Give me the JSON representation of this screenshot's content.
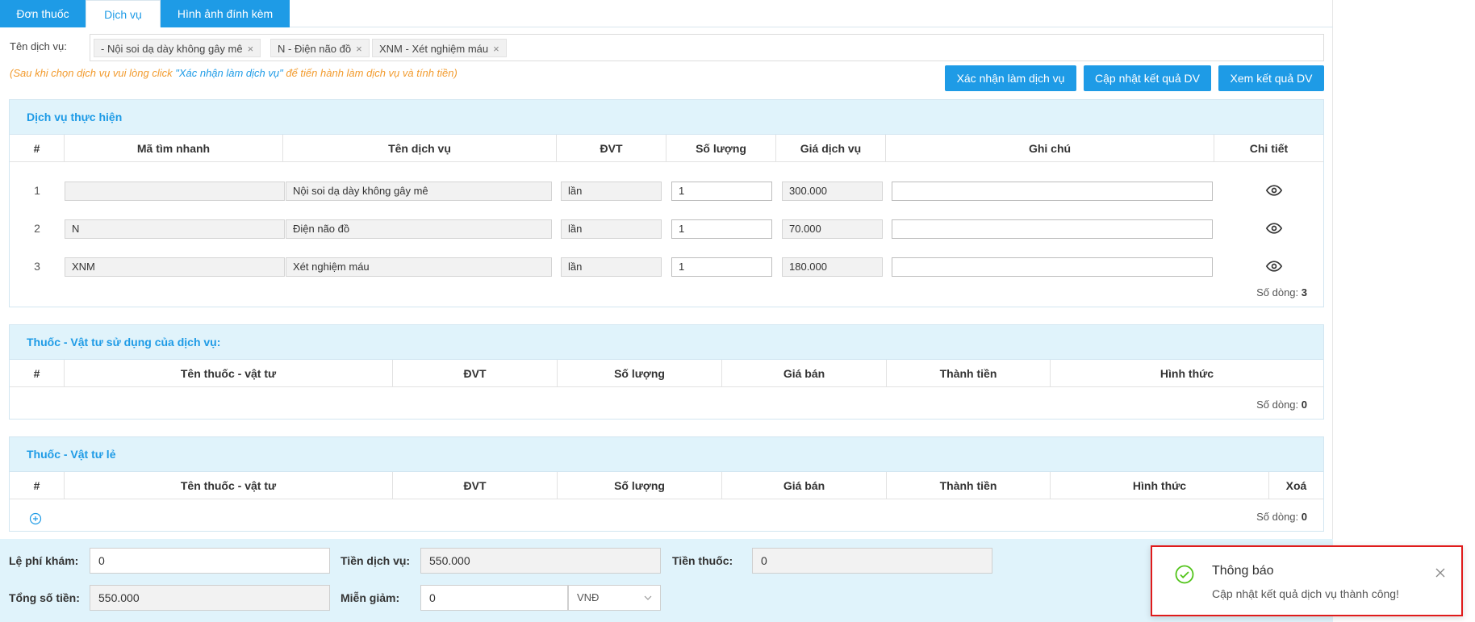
{
  "tabs": [
    {
      "label": "Đơn thuốc"
    },
    {
      "label": "Dịch vụ"
    },
    {
      "label": "Hình ảnh đính kèm"
    }
  ],
  "service_select": {
    "label": "Tên dịch vụ:",
    "tags": [
      {
        "label": "- Nội soi dạ dày không gây mê"
      },
      {
        "label": "N - Điện não đồ"
      },
      {
        "label": "XNM - Xét nghiệm máu"
      }
    ]
  },
  "hint": {
    "prefix": "(Sau khi chọn dịch vụ vui lòng click ",
    "highlight": "\"Xác nhận làm dịch vụ\"",
    "suffix": " để tiến hành làm dịch vụ và tính tiền)"
  },
  "actions": {
    "confirm": "Xác nhận làm dịch vụ",
    "update_result": "Cập nhật kết quả DV",
    "view_result": "Xem kết quả DV"
  },
  "services_panel": {
    "title": "Dịch vụ thực hiện",
    "columns": [
      "#",
      "Mã tìm nhanh",
      "Tên dịch vụ",
      "ĐVT",
      "Số lượng",
      "Giá dịch vụ",
      "Ghi chú",
      "Chi tiết"
    ],
    "rows": [
      {
        "num": "1",
        "code": "",
        "name": "Nội soi dạ dày không gây mê",
        "unit": "lần",
        "qty": "1",
        "price": "300.000",
        "note": ""
      },
      {
        "num": "2",
        "code": "N",
        "name": "Điện não đồ",
        "unit": "lần",
        "qty": "1",
        "price": "70.000",
        "note": ""
      },
      {
        "num": "3",
        "code": "XNM",
        "name": "Xét nghiệm máu",
        "unit": "lần",
        "qty": "1",
        "price": "180.000",
        "note": ""
      }
    ],
    "count_label": "Số dòng:",
    "count": "3"
  },
  "materials_panel": {
    "title": "Thuốc - Vật tư sử dụng của dịch vụ:",
    "columns": [
      "#",
      "Tên thuốc - vật tư",
      "ĐVT",
      "Số lượng",
      "Giá bán",
      "Thành tiền",
      "Hình thức"
    ],
    "count_label": "Số dòng:",
    "count": "0"
  },
  "retail_panel": {
    "title": "Thuốc - Vật tư lẻ",
    "columns": [
      "#",
      "Tên thuốc - vật tư",
      "ĐVT",
      "Số lượng",
      "Giá bán",
      "Thành tiền",
      "Hình thức",
      "Xoá"
    ],
    "count_label": "Số dòng:",
    "count": "0"
  },
  "footer": {
    "exam_fee_label": "Lệ phí khám:",
    "exam_fee": "0",
    "service_fee_label": "Tiền dịch vụ:",
    "service_fee": "550.000",
    "drug_fee_label": "Tiền thuốc:",
    "drug_fee": "0",
    "total_label": "Tổng số tiền:",
    "total": "550.000",
    "discount_label": "Miễn giảm:",
    "discount": "0",
    "currency": "VNĐ"
  },
  "toast": {
    "title": "Thông báo",
    "message": "Cập nhật kết quả dịch vụ thành công!"
  },
  "colors": {
    "primary": "#1e9be6",
    "panel_bg": "#e0f3fb",
    "hint": "#f29b2e",
    "success": "#52c41a",
    "highlight_border": "#e01b1b"
  }
}
